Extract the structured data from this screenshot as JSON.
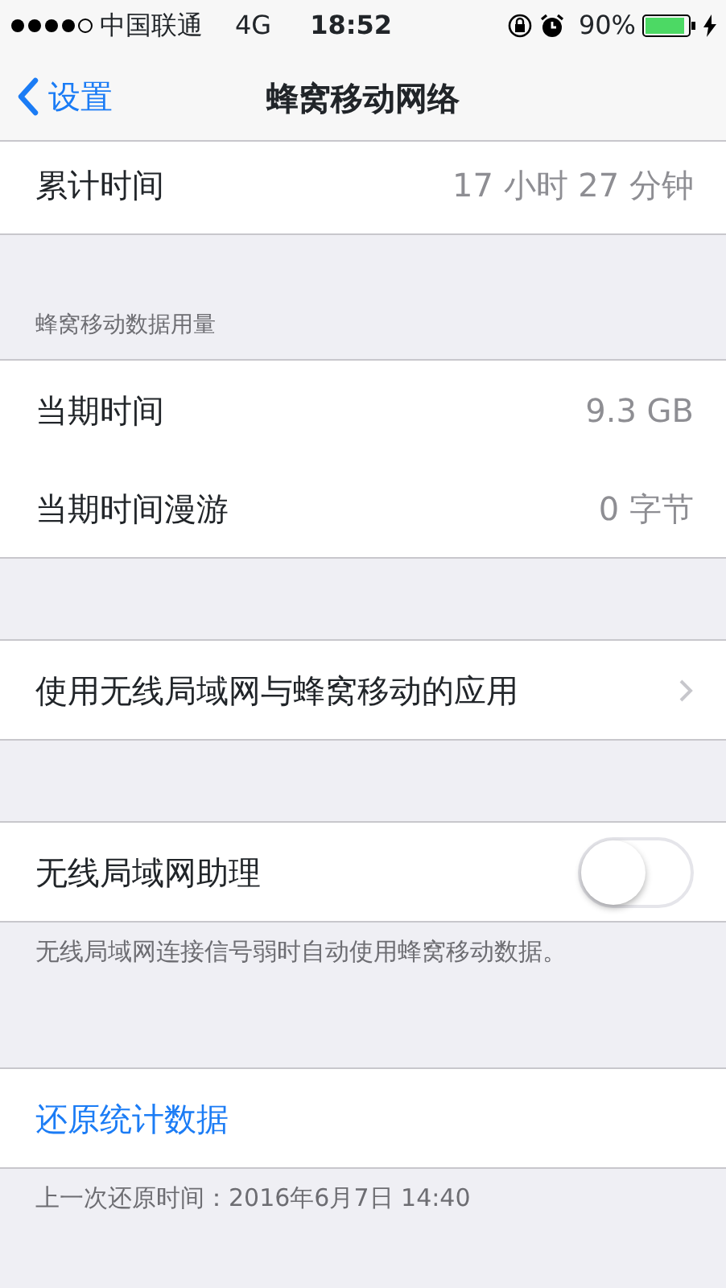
{
  "status_bar": {
    "carrier": "中国联通",
    "network": "4G",
    "time": "18:52",
    "battery": "90%"
  },
  "nav": {
    "back": "设置",
    "title": "蜂窝移动网络"
  },
  "sections": [
    {
      "rows": [
        {
          "kind": "value",
          "label": "累计时间",
          "value": "17 小时 27 分钟"
        }
      ]
    },
    {
      "header": "蜂窝移动数据用量",
      "rows": [
        {
          "kind": "value",
          "label": "当期时间",
          "value": "9.3 GB"
        },
        {
          "kind": "value",
          "label": "当期时间漫游",
          "value": "0 字节"
        }
      ]
    },
    {
      "rows": [
        {
          "kind": "link",
          "label": "使用无线局域网与蜂窝移动的应用"
        }
      ]
    },
    {
      "rows": [
        {
          "kind": "toggle",
          "label": "无线局域网助理",
          "on": false
        }
      ],
      "footer": "无线局域网连接信号弱时自动使用蜂窝移动数据。"
    },
    {
      "rows": [
        {
          "kind": "action",
          "label": "还原统计数据"
        }
      ],
      "footer": "上一次还原时间：2016年6月7日 14:40"
    }
  ]
}
